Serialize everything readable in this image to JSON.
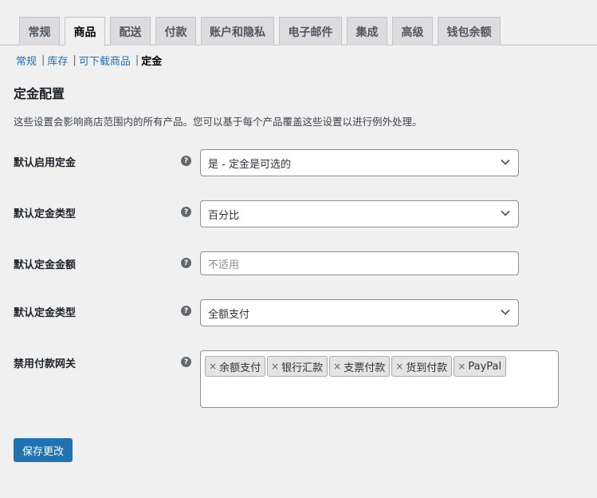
{
  "tabs": [
    {
      "label": "常规",
      "active": false
    },
    {
      "label": "商品",
      "active": true
    },
    {
      "label": "配送",
      "active": false
    },
    {
      "label": "付款",
      "active": false
    },
    {
      "label": "账户和隐私",
      "active": false
    },
    {
      "label": "电子邮件",
      "active": false
    },
    {
      "label": "集成",
      "active": false
    },
    {
      "label": "高级",
      "active": false
    },
    {
      "label": "钱包余额",
      "active": false
    }
  ],
  "subnav": {
    "items": [
      "常规",
      "库存",
      "可下载商品"
    ],
    "current": "定金",
    "separator": "|"
  },
  "section": {
    "title": "定金配置",
    "description": "这些设置会影响商店范围内的所有产品。您可以基于每个产品覆盖这些设置以进行例外处理。"
  },
  "fields": {
    "enable_default": {
      "label": "默认启用定金",
      "value": "是 - 定金是可选的"
    },
    "deposit_type": {
      "label": "默认定金类型",
      "value": "百分比"
    },
    "deposit_amount": {
      "label": "默认定金金额",
      "placeholder": "不适用"
    },
    "deposit_type2": {
      "label": "默认定金类型",
      "value": "全额支付"
    },
    "disabled_gateways": {
      "label": "禁用付款网关",
      "chips": [
        "余额支付",
        "银行汇款",
        "支票付款",
        "货到付款",
        "PayPal"
      ]
    }
  },
  "help_glyph": "?",
  "chip_remove_glyph": "×",
  "save_button": "保存更改",
  "colors": {
    "accent": "#2271b1",
    "background": "#f0f0f1",
    "tab_inactive": "#dcdcde"
  }
}
